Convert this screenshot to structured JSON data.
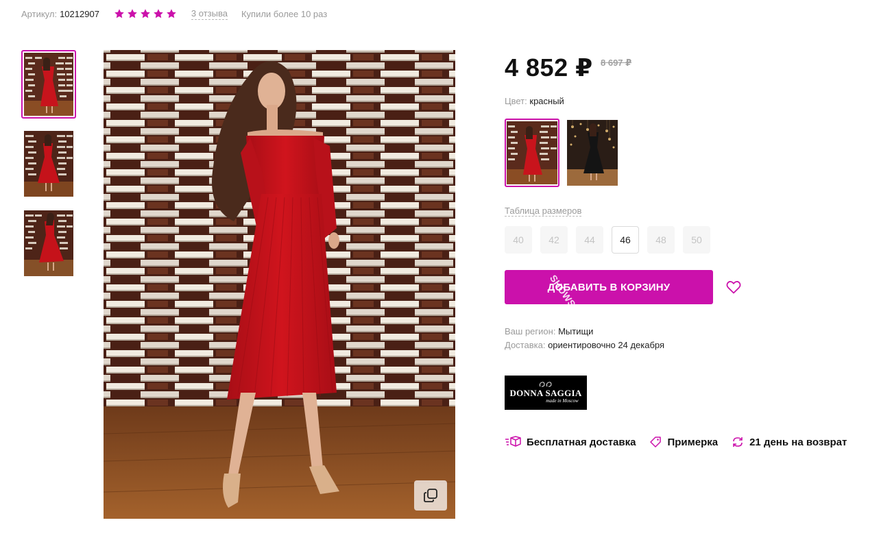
{
  "meta": {
    "article_label": "Артикул:",
    "article_value": "10212907",
    "rating_stars": 5,
    "star_color": "#cb11ab",
    "reviews": "3 отзыва",
    "bought": "Купили более 10 раз"
  },
  "thumbnails": [
    {
      "name": "thumb-1",
      "icon": "red-dress-photo",
      "active": true
    },
    {
      "name": "thumb-2",
      "icon": "red-dress-photo",
      "active": false
    },
    {
      "name": "thumb-3",
      "icon": "red-dress-photo",
      "active": false
    }
  ],
  "price": {
    "current": "4 852 ₽",
    "old": "8 697 ₽"
  },
  "color": {
    "label": "Цвет:",
    "value": "красный"
  },
  "sizes": {
    "table_label": "Таблица размеров",
    "items": [
      "40",
      "42",
      "44",
      "46",
      "48",
      "50"
    ],
    "available": [
      "46"
    ]
  },
  "cart": {
    "button_label": "ДОБАВИТЬ В КОРЗИНУ",
    "watermark": "SHOWS",
    "accent": "#cb11ab"
  },
  "region": {
    "label": "Ваш регион:",
    "value": "Мытищи"
  },
  "delivery": {
    "label": "Доставка:",
    "value": "ориентировочно 24 декабря"
  },
  "brand": {
    "name": "DONNA SAGGIA",
    "sub": "made in Moscow"
  },
  "features": [
    {
      "label": "Бесплатная доставка",
      "icon": "delivery-box-icon"
    },
    {
      "label": "Примерка",
      "icon": "tag-icon"
    },
    {
      "label": "21 день на возврат",
      "icon": "return-arrows-icon"
    }
  ]
}
